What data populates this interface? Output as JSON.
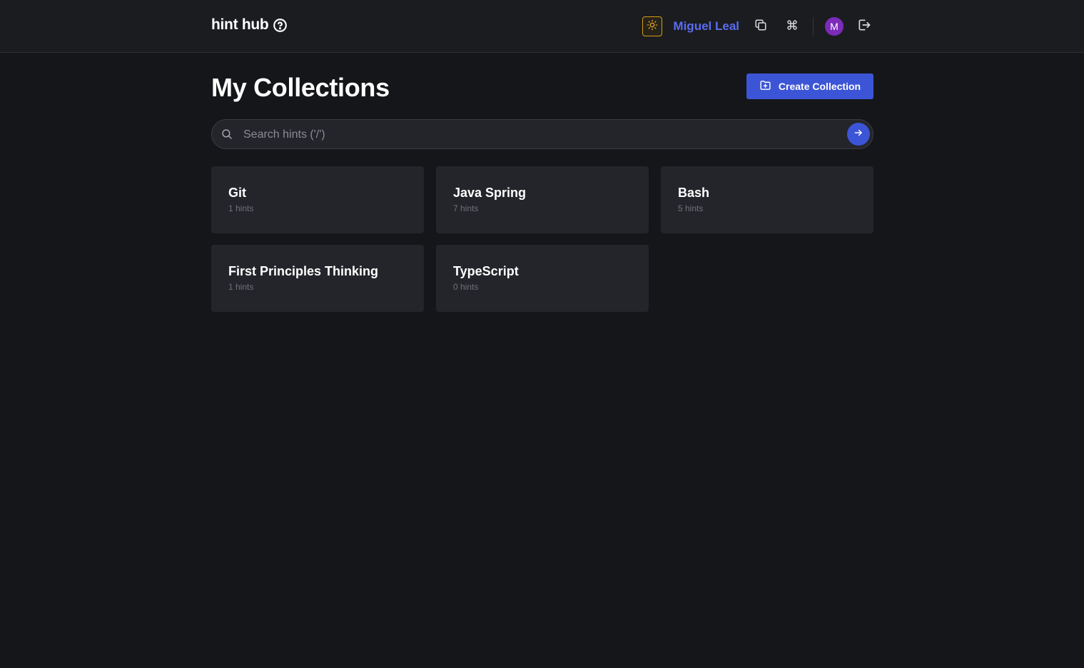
{
  "header": {
    "brand": "hint hub",
    "user_name": "Miguel Leal",
    "avatar_initial": "M",
    "icons": [
      "help-circle-icon",
      "sun-icon",
      "copy-icon",
      "command-icon",
      "logout-icon"
    ]
  },
  "main": {
    "title": "My Collections",
    "create_button_label": "Create Collection",
    "search": {
      "placeholder": "Search hints ('/')",
      "value": ""
    },
    "collections": [
      {
        "name": "Git",
        "count": "1 hints"
      },
      {
        "name": "Java Spring",
        "count": "7 hints"
      },
      {
        "name": "Bash",
        "count": "5 hints"
      },
      {
        "name": "First Principles Thinking",
        "count": "1 hints"
      },
      {
        "name": "TypeScript",
        "count": "0 hints"
      }
    ]
  },
  "colors": {
    "background": "#151619",
    "header_bg": "#1b1c20",
    "card_bg": "#24252b",
    "accent": "#3c55d6",
    "user_link": "#5b6cf0",
    "theme_toggle": "#d89b16",
    "avatar": "#7b2bb8"
  }
}
